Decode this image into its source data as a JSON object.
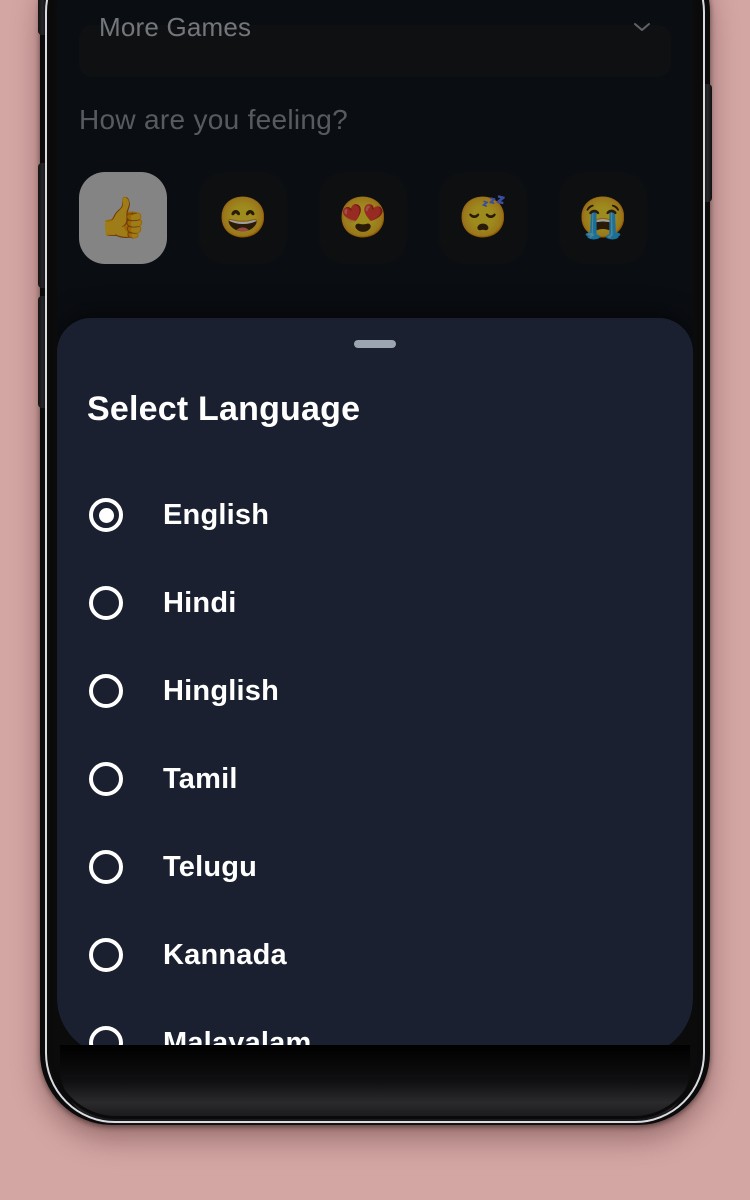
{
  "theme": {
    "page_background": "#d3a6a4",
    "app_background": "#0a0d12",
    "sheet_background": "#1a2030",
    "accent_text": "#ffffff",
    "muted_text": "#8d9399",
    "selected_tile": "#d5d5d5",
    "drag_handle": "#9aa5b1"
  },
  "app": {
    "back_button_icon": "arrow-back-icon",
    "dropdown": {
      "label": "More Games",
      "caret_icon": "chevron-down-icon"
    },
    "feeling_prompt": "How are you feeling?",
    "emoji_options": [
      {
        "name": "thumbs-up",
        "glyph": "👍",
        "selected": true
      },
      {
        "name": "grinning-smiling-eyes",
        "glyph": "😄",
        "selected": false
      },
      {
        "name": "heart-eyes",
        "glyph": "😍",
        "selected": false
      },
      {
        "name": "sleeping-face",
        "glyph": "😴",
        "selected": false
      },
      {
        "name": "loudly-crying-face",
        "glyph": "😭",
        "selected": false
      }
    ]
  },
  "sheet": {
    "title": "Select Language",
    "drag_handle_icon": "drag-handle-icon",
    "languages": [
      {
        "label": "English",
        "selected": true
      },
      {
        "label": "Hindi",
        "selected": false
      },
      {
        "label": "Hinglish",
        "selected": false
      },
      {
        "label": "Tamil",
        "selected": false
      },
      {
        "label": "Telugu",
        "selected": false
      },
      {
        "label": "Kannada",
        "selected": false
      },
      {
        "label": "Malayalam",
        "selected": false
      }
    ]
  }
}
